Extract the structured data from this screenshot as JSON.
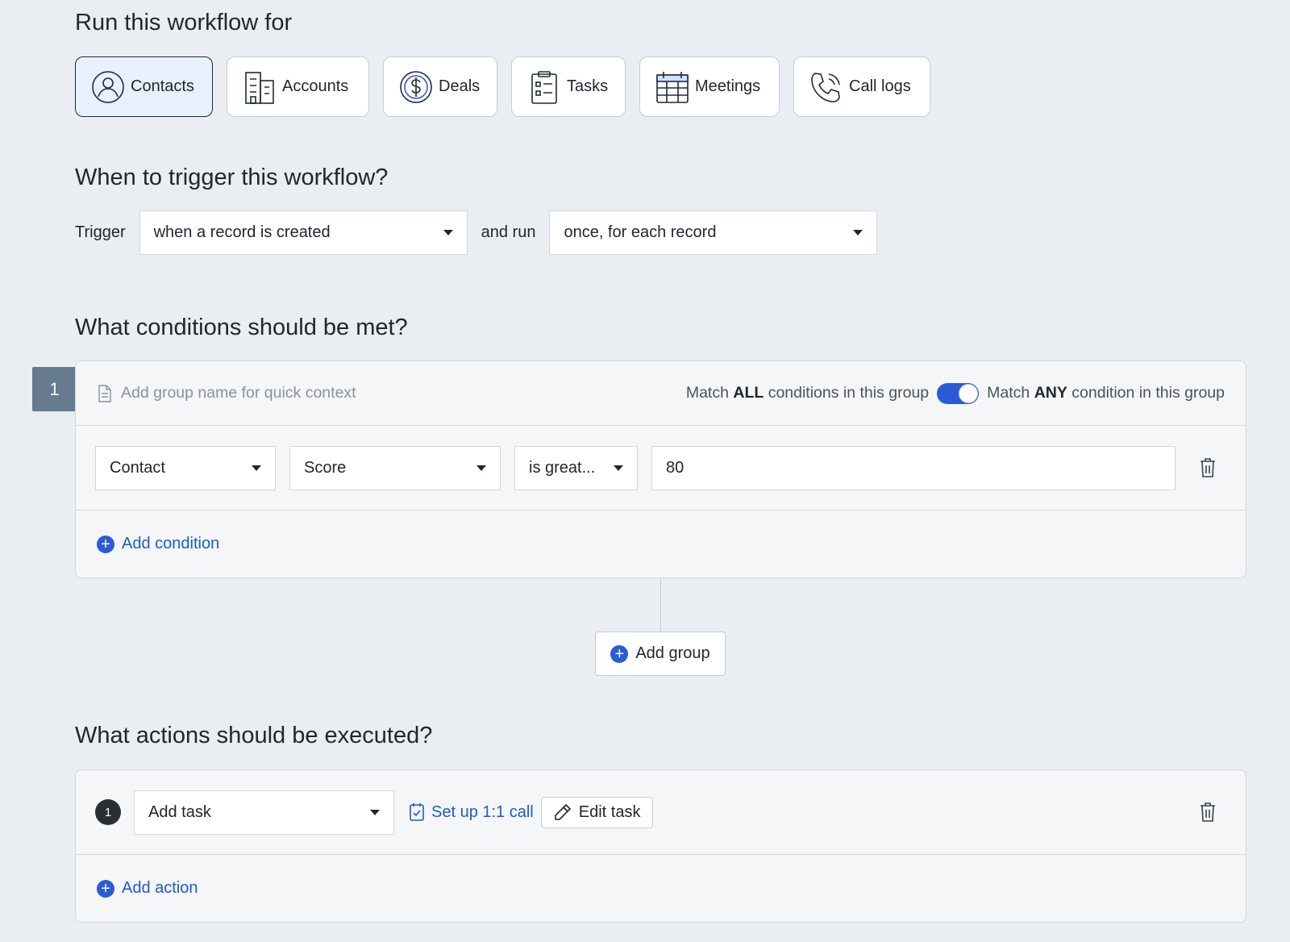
{
  "run_section": {
    "title": "Run this workflow for",
    "modules": [
      {
        "label": "Contacts",
        "icon": "contact-person-icon",
        "active": true
      },
      {
        "label": "Accounts",
        "icon": "building-icon",
        "active": false
      },
      {
        "label": "Deals",
        "icon": "dollar-coin-icon",
        "active": false
      },
      {
        "label": "Tasks",
        "icon": "clipboard-icon",
        "active": false
      },
      {
        "label": "Meetings",
        "icon": "calendar-icon",
        "active": false
      },
      {
        "label": "Call logs",
        "icon": "phone-icon",
        "active": false
      }
    ]
  },
  "trigger_section": {
    "title": "When to trigger this workflow?",
    "trigger_label": "Trigger",
    "trigger_value": "when a record is created",
    "and_run_label": "and run",
    "run_value": "once, for each record"
  },
  "conditions_section": {
    "title": "What conditions should be met?",
    "group": {
      "number": "1",
      "name_placeholder": "Add group name for quick context",
      "match_all_prefix": "Match",
      "match_all_bold": "ALL",
      "match_all_suffix": "conditions in this group",
      "match_any_prefix": "Match",
      "match_any_bold": "ANY",
      "match_any_suffix": "condition in this group",
      "condition": {
        "entity": "Contact",
        "field": "Score",
        "operator": "is great...",
        "value": "80"
      },
      "add_condition_label": "Add condition"
    },
    "add_group_label": "Add group"
  },
  "actions_section": {
    "title": "What actions should be executed?",
    "action": {
      "number": "1",
      "type": "Add task",
      "task_name": "Set up 1:1 call",
      "edit_label": "Edit task"
    },
    "add_action_label": "Add action"
  },
  "colors": {
    "accent": "#2a5bd7",
    "link": "#1e5bc6",
    "group_badge": "#667a90",
    "active_module_bg": "#e6f1fb"
  }
}
